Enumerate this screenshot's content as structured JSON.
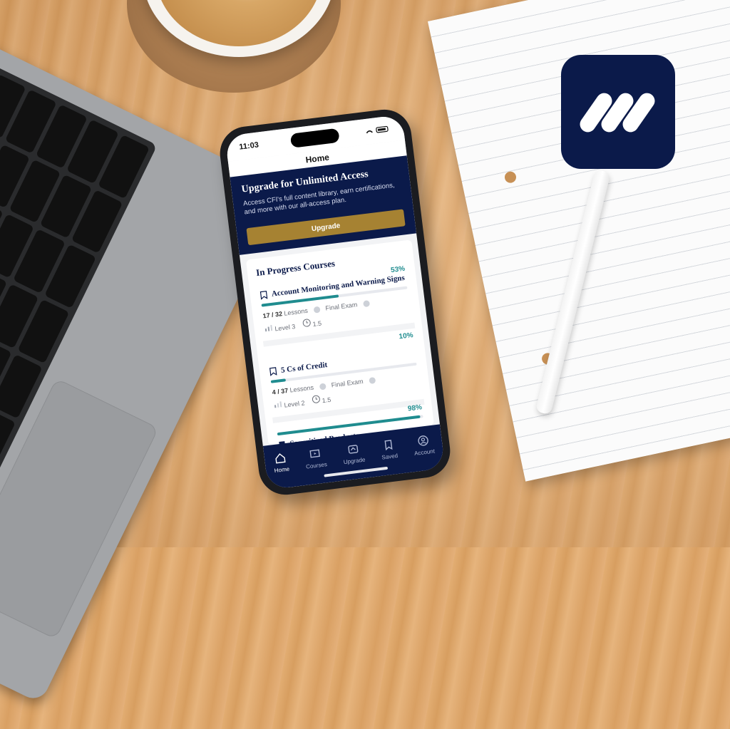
{
  "phone": {
    "time": "11:03",
    "nav_title": "Home"
  },
  "banner": {
    "title": "Upgrade for Unlimited Access",
    "description": "Access CFI's full content library, earn certifications, and more with our all-access plan.",
    "button_label": "Upgrade"
  },
  "in_progress": {
    "section_title": "In Progress Courses",
    "courses": [
      {
        "title": "Account Monitoring and Warning Signs",
        "percent_label": "53%",
        "progress": 0.53,
        "lessons_done": "17 / 32",
        "lessons_label": "Lessons",
        "final_exam_label": "Final Exam",
        "level_label": "Level 3",
        "duration_label": "1.5"
      },
      {
        "title": "5 Cs of Credit",
        "percent_label": "10%",
        "progress": 0.1,
        "lessons_done": "4 / 37",
        "lessons_label": "Lessons",
        "final_exam_label": "Final Exam",
        "level_label": "Level 2",
        "duration_label": "1.5"
      },
      {
        "title": "Securitized Products",
        "percent_label": "98%",
        "progress": 0.98
      }
    ]
  },
  "tabbar": {
    "items": [
      {
        "label": "Home",
        "icon": "home-icon"
      },
      {
        "label": "Courses",
        "icon": "courses-icon"
      },
      {
        "label": "Upgrade",
        "icon": "upgrade-icon"
      },
      {
        "label": "Saved",
        "icon": "bookmark-icon"
      },
      {
        "label": "Account",
        "icon": "account-icon"
      }
    ]
  },
  "colors": {
    "navy": "#0b1a4a",
    "gold": "#a68232",
    "teal": "#1f8c8f"
  }
}
